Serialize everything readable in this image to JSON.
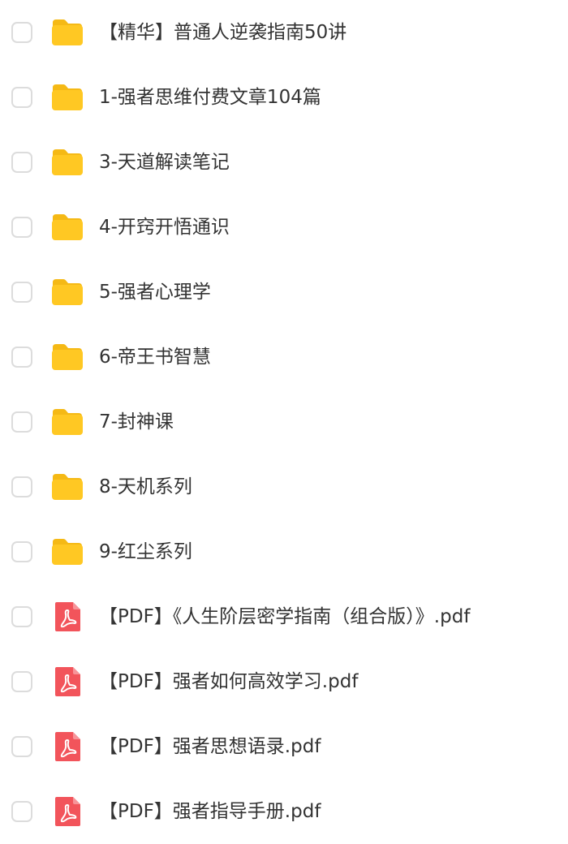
{
  "files": [
    {
      "name": "【精华】普通人逆袭指南50讲",
      "type": "folder",
      "icon": "folder-icon"
    },
    {
      "name": "1-强者思维付费文章104篇",
      "type": "folder",
      "icon": "folder-icon"
    },
    {
      "name": "3-天道解读笔记",
      "type": "folder",
      "icon": "folder-icon"
    },
    {
      "name": "4-开窍开悟通识",
      "type": "folder",
      "icon": "folder-icon"
    },
    {
      "name": "5-强者心理学",
      "type": "folder",
      "icon": "folder-icon"
    },
    {
      "name": "6-帝王书智慧",
      "type": "folder",
      "icon": "folder-icon"
    },
    {
      "name": "7-封神课",
      "type": "folder",
      "icon": "folder-icon"
    },
    {
      "name": "8-天机系列",
      "type": "folder",
      "icon": "folder-icon"
    },
    {
      "name": "9-红尘系列",
      "type": "folder",
      "icon": "folder-icon"
    },
    {
      "name": "【PDF】《人生阶层密学指南（组合版）》.pdf",
      "type": "pdf",
      "icon": "pdf-icon"
    },
    {
      "name": "【PDF】强者如何高效学习.pdf",
      "type": "pdf",
      "icon": "pdf-icon"
    },
    {
      "name": "【PDF】强者思想语录.pdf",
      "type": "pdf",
      "icon": "pdf-icon"
    },
    {
      "name": "【PDF】强者指导手册.pdf",
      "type": "pdf",
      "icon": "pdf-icon"
    }
  ],
  "colors": {
    "folder": "#FFC823",
    "folder_tab": "#F5B915",
    "pdf": "#F2545B",
    "text": "#333333",
    "checkbox_border": "#DCDCDC"
  }
}
